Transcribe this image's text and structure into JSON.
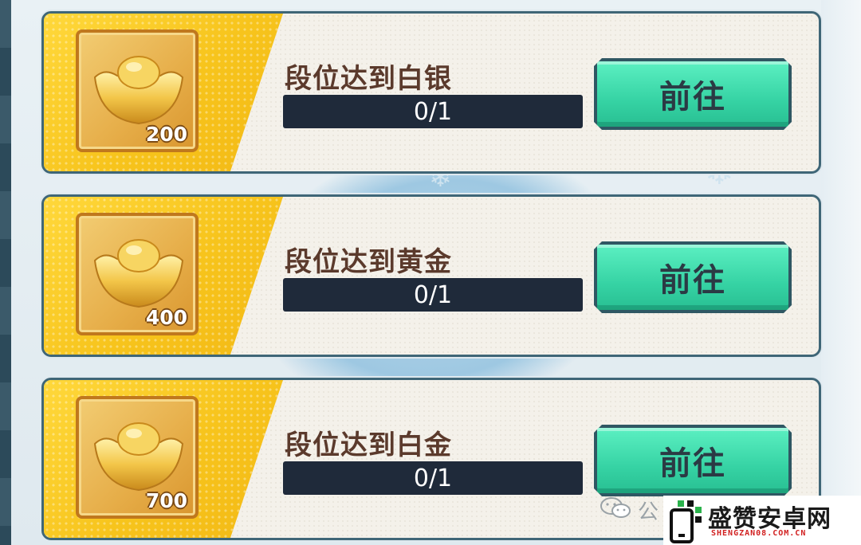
{
  "tasks": [
    {
      "title": "段位达到白银",
      "reward_amount": "200",
      "reward_icon": "gold-ingot-icon",
      "progress_text": "0/1",
      "progress_fraction": 0,
      "button_label": "前往"
    },
    {
      "title": "段位达到黄金",
      "reward_amount": "400",
      "reward_icon": "gold-ingot-icon",
      "progress_text": "0/1",
      "progress_fraction": 0,
      "button_label": "前往"
    },
    {
      "title": "段位达到白金",
      "reward_amount": "700",
      "reward_icon": "gold-ingot-icon",
      "progress_text": "0/1",
      "progress_fraction": 0,
      "button_label": "前往"
    }
  ],
  "watermark": {
    "prefix": "公",
    "site_name": "盛赞安卓网",
    "site_domain": "SHENGZAN08.COM.CN"
  },
  "colors": {
    "card_border": "#3f6677",
    "yellow_panel": "#f7c41c",
    "button_green": "#36d3a4",
    "progress_track": "#1f2a3a",
    "title_text": "#5b3a2c"
  }
}
